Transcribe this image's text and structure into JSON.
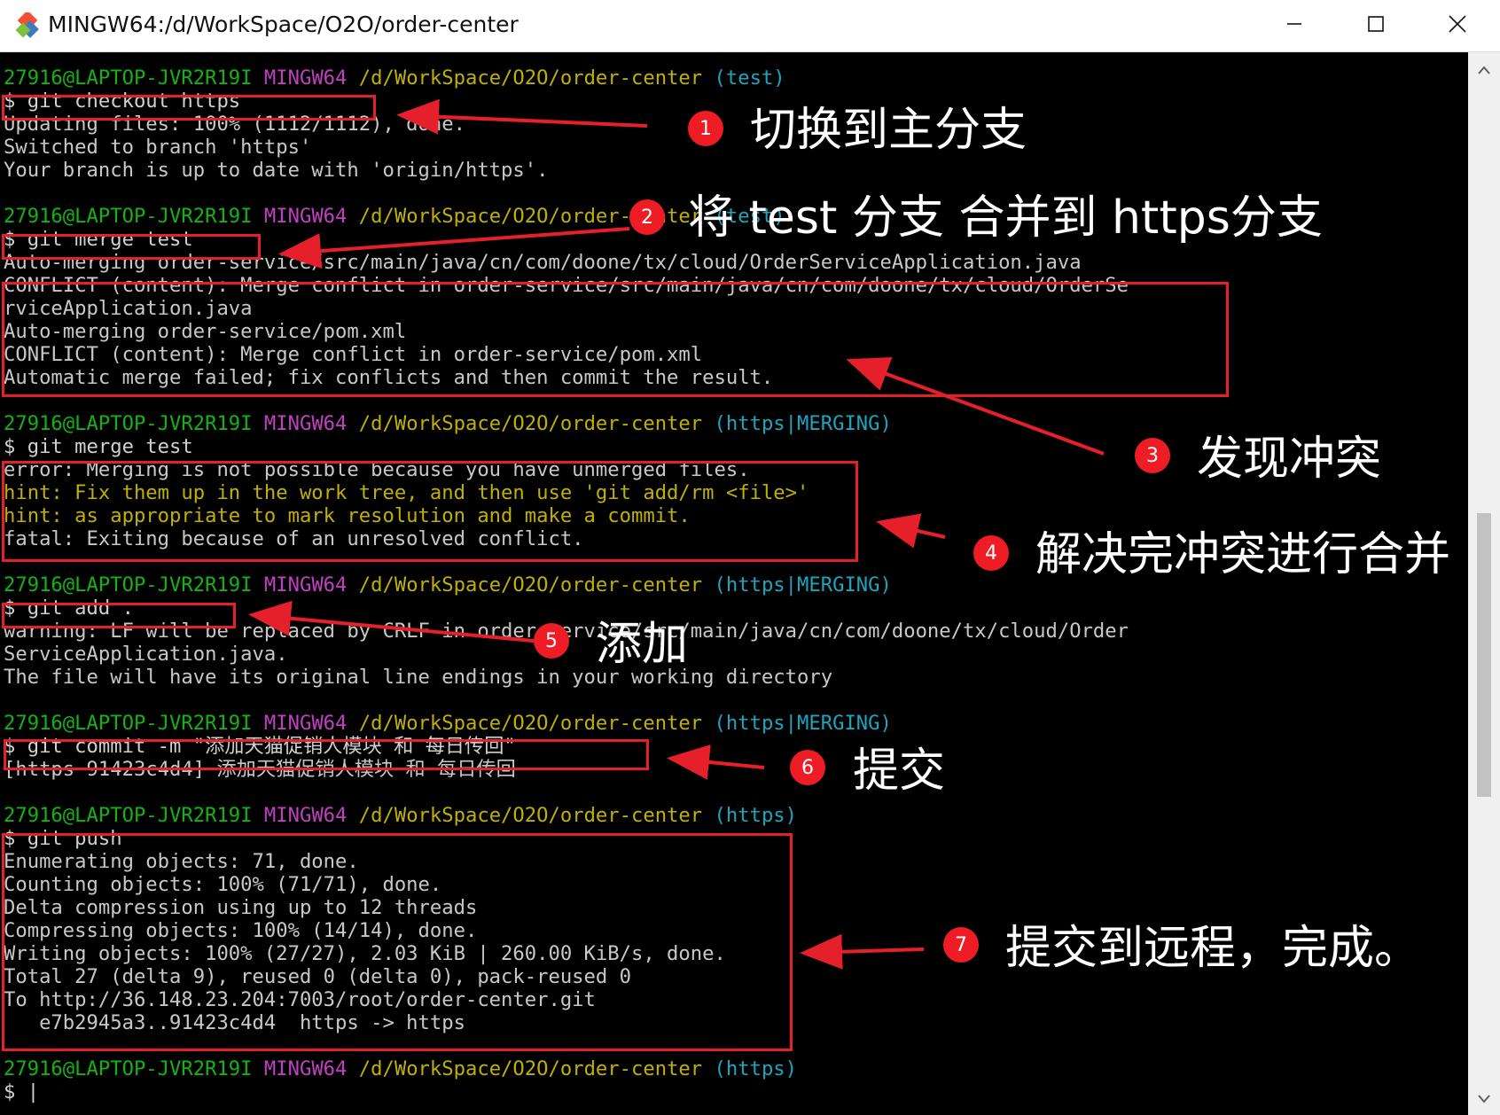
{
  "window": {
    "title": "MINGW64:/d/WorkSpace/O2O/order-center",
    "icon": "git-bash-icon",
    "controls": [
      "minimize-icon",
      "maximize-icon",
      "close-icon"
    ]
  },
  "prompt": {
    "user": "27916@LAPTOP-JVR2R19I",
    "shell": "MINGW64",
    "path": "/d/WorkSpace/O2O/order-center",
    "branches": [
      "(test)",
      "(test)",
      "(https|MERGING)",
      "(https|MERGING)",
      "(https|MERGING)",
      "(https)",
      "(https)"
    ]
  },
  "terminal": {
    "cmd1": "$ git checkout https",
    "out1": [
      "Updating files: 100% (1112/1112), done.",
      "Switched to branch 'https'",
      "Your branch is up to date with 'origin/https'."
    ],
    "cmd2": "$ git merge test",
    "out2": [
      "Auto-merging order-service/src/main/java/cn/com/doone/tx/cloud/OrderServiceApplication.java",
      "CONFLICT (content): Merge conflict in order-service/src/main/java/cn/com/doone/tx/cloud/OrderSe",
      "rviceApplication.java",
      "Auto-merging order-service/pom.xml",
      "CONFLICT (content): Merge conflict in order-service/pom.xml",
      "Automatic merge failed; fix conflicts and then commit the result."
    ],
    "cmd3": "$ git merge test",
    "out3_error": "error: Merging is not possible because you have unmerged files.",
    "out3_hints": [
      "hint: Fix them up in the work tree, and then use 'git add/rm <file>'",
      "hint: as appropriate to mark resolution and make a commit."
    ],
    "out3_fatal": "fatal: Exiting because of an unresolved conflict.",
    "cmd4": "$ git add .",
    "out4": [
      "warning: LF will be replaced by CRLF in order-service/src/main/java/cn/com/doone/tx/cloud/Order",
      "ServiceApplication.java.",
      "The file will have its original line endings in your working directory"
    ],
    "cmd5": "$ git commit -m \"添加天猫促销人模块 和 每日传回\"",
    "out5": [
      "[https 91423c4d4] 添加天猫促销人模块 和 每日传回"
    ],
    "cmd6": "$ git push",
    "out6": [
      "Enumerating objects: 71, done.",
      "Counting objects: 100% (71/71), done.",
      "Delta compression using up to 12 threads",
      "Compressing objects: 100% (14/14), done.",
      "Writing objects: 100% (27/27), 2.03 KiB | 260.00 KiB/s, done.",
      "Total 27 (delta 9), reused 0 (delta 0), pack-reused 0",
      "To http://36.148.23.204:7003/root/order-center.git",
      "   e7b2945a3..91423c4d4  https -> https"
    ],
    "final_prompt": "$ |"
  },
  "annotations": [
    {
      "num": "1",
      "text": "切换到主分支"
    },
    {
      "num": "2",
      "text": "将 test 分支 合并到 https分支"
    },
    {
      "num": "3",
      "text": "发现冲突"
    },
    {
      "num": "4",
      "text": "解决完冲突进行合并"
    },
    {
      "num": "5",
      "text": "添加"
    },
    {
      "num": "6",
      "text": "提交"
    },
    {
      "num": "7",
      "text": "提交到远程，完成。"
    }
  ],
  "colors": {
    "prompt_user": "#13b313",
    "prompt_shell": "#c040c0",
    "prompt_path": "#c0b000",
    "prompt_branch": "#1aa6bf",
    "annotation_red": "#e5202b",
    "terminal_bg": "#000000"
  }
}
